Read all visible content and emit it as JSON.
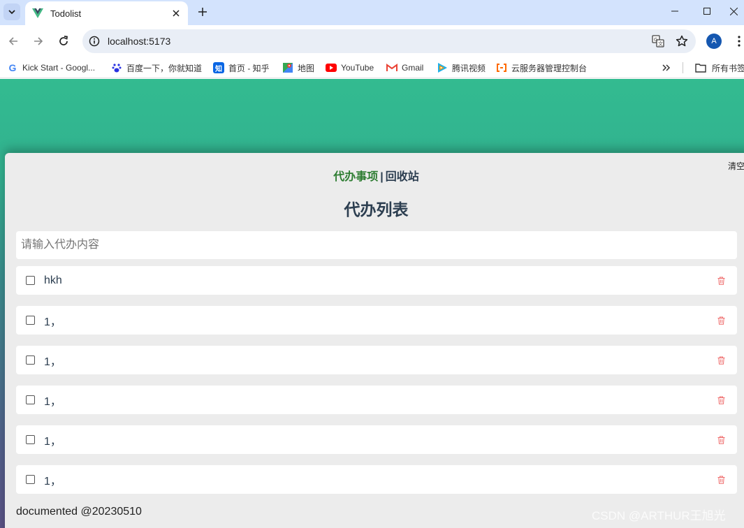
{
  "browser": {
    "tab_title": "Todolist",
    "url": "localhost:5173",
    "avatar_letter": "A"
  },
  "bookmarks": [
    {
      "label": "Kick Start - Googl...",
      "icon": "google-icon"
    },
    {
      "label": "百度一下，你就知道",
      "icon": "baidu-icon"
    },
    {
      "label": "首页 - 知乎",
      "icon": "zhihu-icon"
    },
    {
      "label": "地图",
      "icon": "maps-icon"
    },
    {
      "label": "YouTube",
      "icon": "youtube-icon"
    },
    {
      "label": "Gmail",
      "icon": "gmail-icon"
    },
    {
      "label": "腾讯视频",
      "icon": "tencent-video-icon"
    },
    {
      "label": "云服务器管理控制台",
      "icon": "aliyun-icon"
    }
  ],
  "bookmarks_all_label": "所有书签",
  "app": {
    "clear_label": "清空",
    "nav_todo": "代办事项",
    "nav_separator": "|",
    "nav_recycle": "回收站",
    "list_title": "代办列表",
    "input_placeholder": "请输入代办内容",
    "todos": [
      {
        "text": "hkh",
        "done": false
      },
      {
        "text": "1，",
        "done": false
      },
      {
        "text": "1，",
        "done": false
      },
      {
        "text": "1，",
        "done": false
      },
      {
        "text": "1，",
        "done": false
      },
      {
        "text": "1，",
        "done": false
      }
    ],
    "footer": "documented @20230510"
  },
  "watermark": "CSDN @ARTHUR王旭光",
  "colors": {
    "tabstrip": "#d3e3fd",
    "gradient_top": "#33bb90",
    "gradient_bottom": "#5b5387",
    "nav_active": "#2e7d32",
    "text": "#2c3e50",
    "delete_icon": "#ef6b6b"
  }
}
